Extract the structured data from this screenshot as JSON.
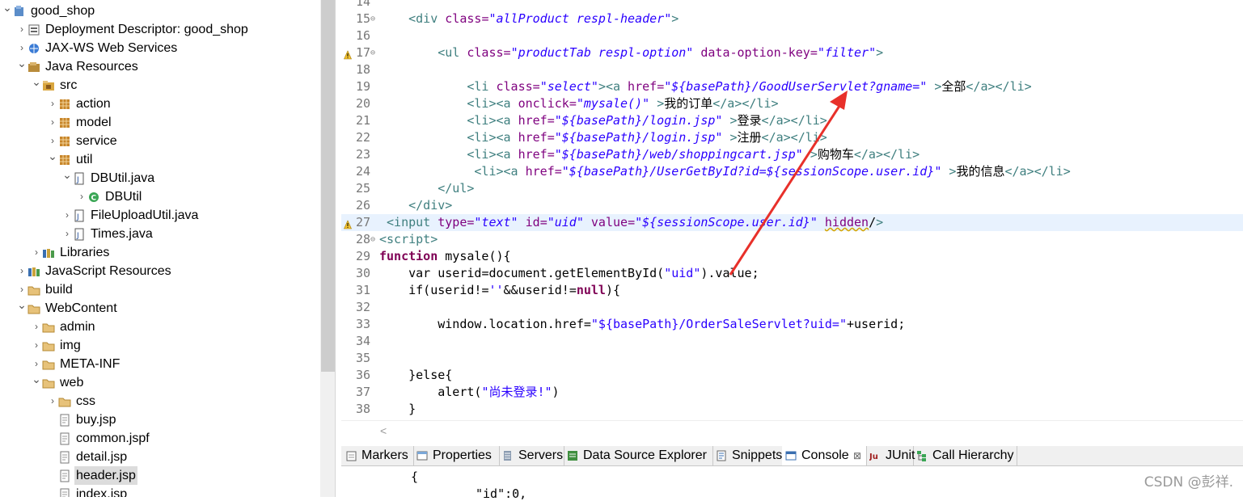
{
  "explorer": {
    "items": [
      {
        "label": "good_shop",
        "expanded": true,
        "icon": "project-icon"
      },
      {
        "label": "Deployment Descriptor: good_shop",
        "expanded": false,
        "icon": "deployment-descriptor-icon"
      },
      {
        "label": "JAX-WS Web Services",
        "expanded": false,
        "icon": "web-services-icon"
      },
      {
        "label": "Java Resources",
        "expanded": true,
        "icon": "java-resources-icon"
      },
      {
        "label": "src",
        "expanded": true,
        "icon": "source-folder-icon"
      },
      {
        "label": "action",
        "expanded": false,
        "icon": "package-icon"
      },
      {
        "label": "model",
        "expanded": false,
        "icon": "package-icon"
      },
      {
        "label": "service",
        "expanded": false,
        "icon": "package-icon"
      },
      {
        "label": "util",
        "expanded": true,
        "icon": "package-icon"
      },
      {
        "label": "DBUtil.java",
        "expanded": true,
        "icon": "java-file-icon"
      },
      {
        "label": "DBUtil",
        "expanded": false,
        "icon": "class-icon"
      },
      {
        "label": "FileUploadUtil.java",
        "expanded": false,
        "icon": "java-file-icon"
      },
      {
        "label": "Times.java",
        "expanded": false,
        "icon": "java-file-icon"
      },
      {
        "label": "Libraries",
        "expanded": false,
        "icon": "libraries-icon"
      },
      {
        "label": "JavaScript Resources",
        "expanded": false,
        "icon": "javascript-resources-icon"
      },
      {
        "label": "build",
        "expanded": false,
        "icon": "folder-icon"
      },
      {
        "label": "WebContent",
        "expanded": true,
        "icon": "folder-icon"
      },
      {
        "label": "admin",
        "expanded": false,
        "icon": "folder-icon"
      },
      {
        "label": "img",
        "expanded": false,
        "icon": "folder-icon"
      },
      {
        "label": "META-INF",
        "expanded": false,
        "icon": "folder-icon"
      },
      {
        "label": "web",
        "expanded": true,
        "icon": "folder-icon"
      },
      {
        "label": "css",
        "expanded": false,
        "icon": "folder-icon"
      },
      {
        "label": "buy.jsp",
        "expanded": false,
        "icon": "jsp-file-icon"
      },
      {
        "label": "common.jspf",
        "expanded": false,
        "icon": "jsp-file-icon"
      },
      {
        "label": "detail.jsp",
        "expanded": false,
        "icon": "jsp-file-icon"
      },
      {
        "label": "header.jsp",
        "expanded": false,
        "icon": "jsp-file-icon",
        "selected": true
      },
      {
        "label": "index.jsp",
        "expanded": false,
        "icon": "jsp-file-icon"
      }
    ]
  },
  "editor": {
    "lines": [
      {
        "n": "14",
        "code": ""
      },
      {
        "n": "15",
        "code": "    <div class=\"allProduct respl-header\">"
      },
      {
        "n": "16",
        "code": ""
      },
      {
        "n": "17",
        "code": "        <ul class=\"productTab respl-option\" data-option-key=\"filter\">"
      },
      {
        "n": "18",
        "code": ""
      },
      {
        "n": "19",
        "code": "            <li class=\"select\"><a href=\"${basePath}/GoodUserServlet?gname=\" >全部</a></li>"
      },
      {
        "n": "20",
        "code": "            <li><a onclick=\"mysale()\" >我的订单</a></li>"
      },
      {
        "n": "21",
        "code": "            <li><a href=\"${basePath}/login.jsp\" >登录</a></li>"
      },
      {
        "n": "22",
        "code": "            <li><a href=\"${basePath}/login.jsp\" >注册</a></li>"
      },
      {
        "n": "23",
        "code": "            <li><a href=\"${basePath}/web/shoppingcart.jsp\" >购物车</a></li>"
      },
      {
        "n": "24",
        "code": "             <li><a href=\"${basePath}/UserGetById?id=${sessionScope.user.id}\" >我的信息</a></li>"
      },
      {
        "n": "25",
        "code": "        </ul>"
      },
      {
        "n": "26",
        "code": "    </div>"
      },
      {
        "n": "27",
        "code": " <input type=\"text\" id=\"uid\" value=\"${sessionScope.user.id}\" hidden/>"
      },
      {
        "n": "28",
        "code": "<script>"
      },
      {
        "n": "29",
        "code": "function mysale(){"
      },
      {
        "n": "30",
        "code": "    var userid=document.getElementById(\"uid\").value;"
      },
      {
        "n": "31",
        "code": "    if(userid!=''&&userid!=null){"
      },
      {
        "n": "32",
        "code": ""
      },
      {
        "n": "33",
        "code": "        window.location.href=\"${basePath}/OrderSaleServlet?uid=\"+userid;"
      },
      {
        "n": "34",
        "code": ""
      },
      {
        "n": "35",
        "code": ""
      },
      {
        "n": "36",
        "code": "    }else{"
      },
      {
        "n": "37",
        "code": "        alert(\"尚未登录!\")"
      },
      {
        "n": "38",
        "code": "    }"
      }
    ]
  },
  "panel": {
    "tabs": [
      {
        "label": "Markers",
        "icon": "markers-icon"
      },
      {
        "label": "Properties",
        "icon": "properties-icon"
      },
      {
        "label": "Servers",
        "icon": "servers-icon"
      },
      {
        "label": "Data Source Explorer",
        "icon": "data-source-icon"
      },
      {
        "label": "Snippets",
        "icon": "snippets-icon"
      },
      {
        "label": "Console",
        "icon": "console-icon",
        "active": true,
        "close": "⊠"
      },
      {
        "label": "JUnit",
        "icon": "junit-icon"
      },
      {
        "label": "Call Hierarchy",
        "icon": "call-hierarchy-icon"
      }
    ],
    "console_lines": [
      "{",
      "\"id\":0,"
    ]
  },
  "watermark": "CSDN @彭祥.",
  "colors": {
    "annotation_arrow": "#e8302a",
    "highlight_line": "#e8f2fe"
  }
}
